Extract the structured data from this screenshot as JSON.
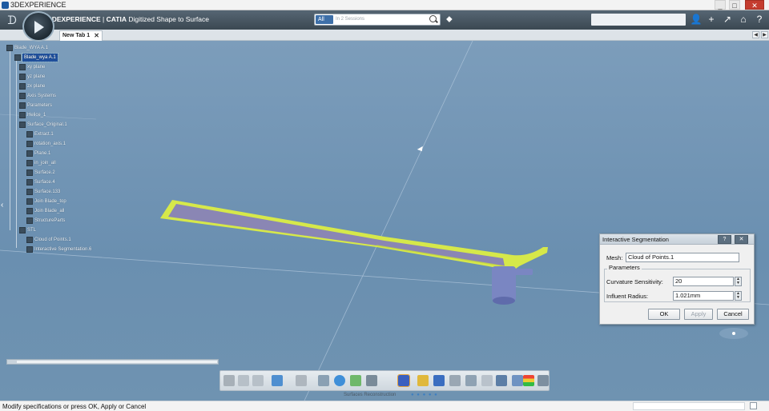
{
  "window": {
    "title": "3DEXPERIENCE",
    "min": "_",
    "max": "□",
    "close": "✕"
  },
  "topbar": {
    "brand_prefix": "3DEXPERIENCE",
    "brand_app": "CATIA",
    "brand_title": "Digitized Shape to Surface",
    "search_scope": "All",
    "search_placeholder": "In 2 Sessions",
    "buttons": [
      {
        "name": "user-icon",
        "glyph": "👤"
      },
      {
        "name": "add-icon",
        "glyph": "+"
      },
      {
        "name": "share-icon",
        "glyph": "↗"
      },
      {
        "name": "home-icon",
        "glyph": "⌂"
      },
      {
        "name": "help-icon",
        "glyph": "?"
      }
    ]
  },
  "tabs": [
    {
      "label": "New Tab 1",
      "close": "✕"
    }
  ],
  "tab_nav": {
    "prev": "◀",
    "next": "▶"
  },
  "tree": {
    "root": "Blade_WYA A.1",
    "nodes": [
      {
        "label": "Blade_wya A.1",
        "selected": true
      },
      {
        "label": "xy plane"
      },
      {
        "label": "yz plane"
      },
      {
        "label": "zx plane"
      },
      {
        "label": "Axis Systems"
      },
      {
        "label": "Parameters"
      },
      {
        "label": "Helice_1"
      },
      {
        "label": "Surface_Original.1"
      },
      {
        "label": "Extract.1"
      },
      {
        "label": "rotation_axis.1"
      },
      {
        "label": "Plane.1"
      },
      {
        "label": "in_join_all"
      },
      {
        "label": "Surface.2"
      },
      {
        "label": "Surface.4"
      },
      {
        "label": "Surface.133"
      },
      {
        "label": "Join Blade_top"
      },
      {
        "label": "Join Blade_all"
      },
      {
        "label": "StructureParts"
      },
      {
        "label": "STL"
      },
      {
        "label": "Cloud of Points.1"
      },
      {
        "label": "Interactive Segmentation.6"
      }
    ]
  },
  "dialog": {
    "title": "Interactive Segmentation",
    "help": "?",
    "close": "✕",
    "mesh_label": "Mesh:",
    "mesh_value": "Cloud of Points.1",
    "parameters_title": "Parameters",
    "curvature_label": "Curvature Sensitivity:",
    "curvature_value": "20",
    "radius_label": "Influent Radius:",
    "radius_value": "1.021mm",
    "ok": "OK",
    "apply": "Apply",
    "cancel": "Cancel"
  },
  "toolbar": {
    "workbench": "Surfaces Reconstruction",
    "page_dots": "● ● ● ● ●"
  },
  "status": {
    "message": "Modify specifications or press OK, Apply or Cancel"
  },
  "colors": {
    "blade_yellow": "#d6e84a",
    "blade_body": "#8a86b4",
    "hub": "#7a86c2",
    "viewport": "#6f93b2"
  }
}
